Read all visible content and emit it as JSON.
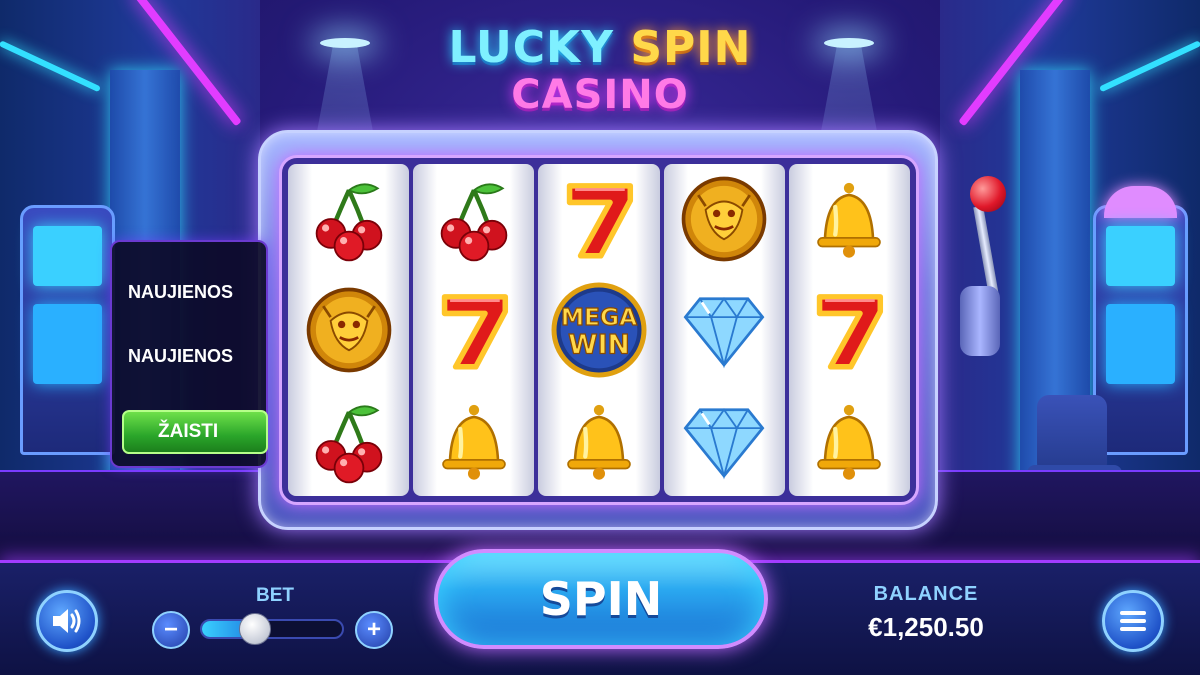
{
  "title": {
    "line1_word1": "LUCKY",
    "line1_word2": "SPIN",
    "line2": "CASINO"
  },
  "side_menu": {
    "items": [
      "NAUJIENOS",
      "NAUJIENOS"
    ],
    "play_label": "ŽAISTI"
  },
  "reels": [
    [
      "cherry",
      "dragon",
      "cherry"
    ],
    [
      "cherry",
      "seven",
      "bell"
    ],
    [
      "seven",
      "mega-win",
      "bell"
    ],
    [
      "dragon",
      "diamond",
      "diamond"
    ],
    [
      "bell",
      "seven",
      "bell"
    ]
  ],
  "mega_win": {
    "line1": "MEGA",
    "line2": "WIN"
  },
  "bet": {
    "label": "BET",
    "minus": "−",
    "plus": "+",
    "level": 0.38
  },
  "spin": {
    "label": "SPIN"
  },
  "balance": {
    "label": "BALANCE",
    "value": "€1,250.50"
  },
  "icons": {
    "sound": "speaker-icon",
    "menu": "hamburger-menu-icon"
  },
  "colors": {
    "accent_pink": "#e23cff",
    "accent_cyan": "#33e0ff",
    "play_green": "#2aa52a",
    "title_gold": "#ffd84a"
  }
}
